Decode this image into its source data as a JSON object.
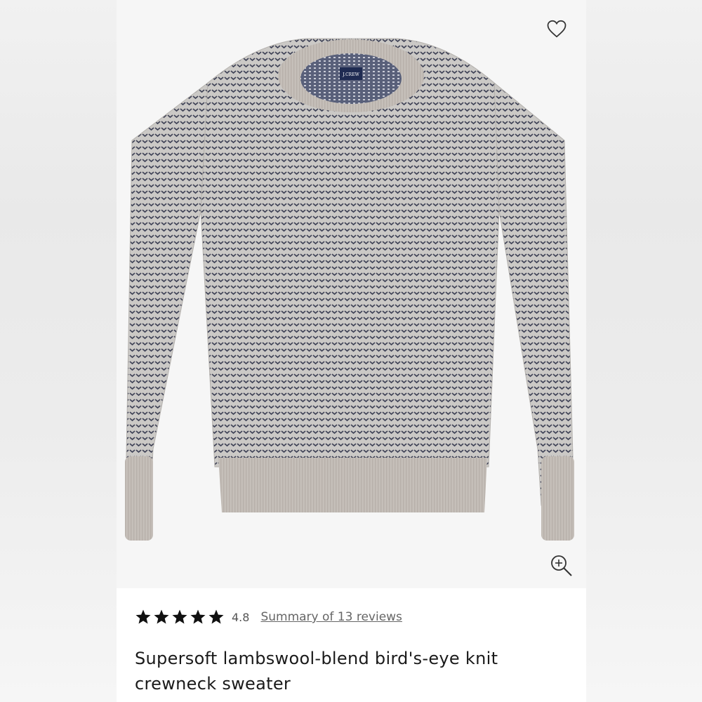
{
  "product": {
    "brand_label": "J.CREW",
    "rating_value": "4.8",
    "rating_stars": 5,
    "reviews_link": "Summary of 13 reviews",
    "title": "Supersoft lambswool-blend bird's-eye knit crewneck sweater"
  },
  "icons": {
    "favorite": "heart-outline-icon",
    "zoom": "zoom-in-icon",
    "star": "star-filled-icon"
  },
  "colors": {
    "knit_light": "#c9c7c4",
    "knit_dark": "#3f4256",
    "rib": "#c3bdb7",
    "text": "#1a1a1a",
    "link": "#666666"
  }
}
